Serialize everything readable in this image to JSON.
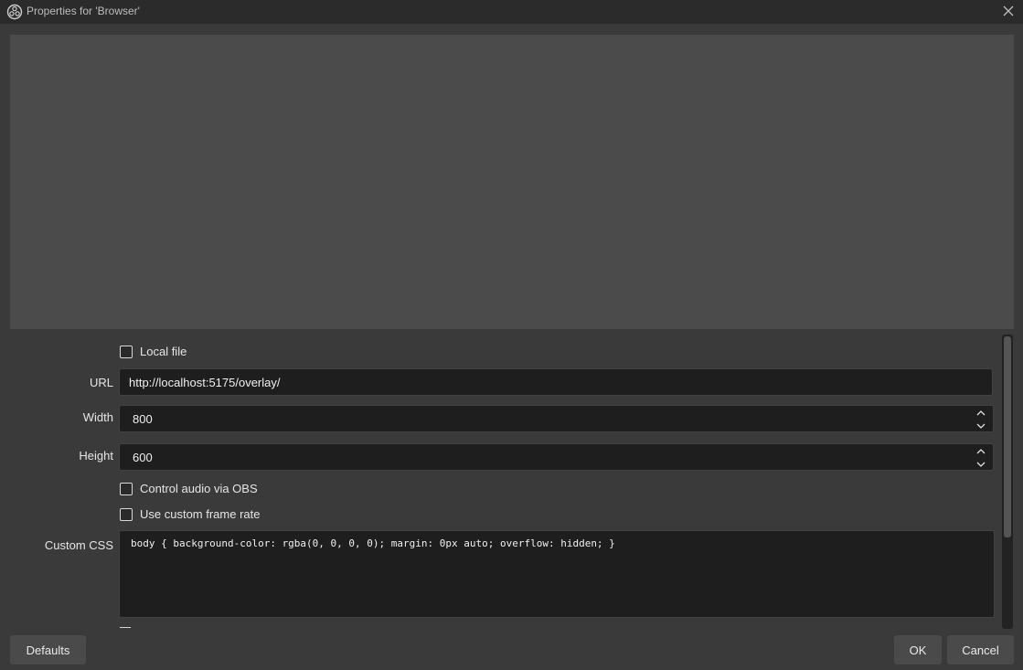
{
  "window": {
    "title": "Properties for 'Browser'"
  },
  "properties": {
    "local_file_label": "Local file",
    "url_label": "URL",
    "url_value": "http://localhost:5175/overlay/",
    "width_label": "Width",
    "width_value": "800",
    "height_label": "Height",
    "height_value": "600",
    "control_audio_label": "Control audio via OBS",
    "custom_frame_rate_label": "Use custom frame rate",
    "custom_css_label": "Custom CSS",
    "custom_css_value": "body { background-color: rgba(0, 0, 0, 0); margin: 0px auto; overflow: hidden; }"
  },
  "buttons": {
    "defaults": "Defaults",
    "ok": "OK",
    "cancel": "Cancel"
  },
  "colors": {
    "background": "#3a3a3a",
    "titlebar": "#2b2b2b",
    "preview": "#4b4b4b",
    "input": "#1e1e1e",
    "button": "#4a4a4a"
  },
  "icons": {
    "app": "obs-logo-icon",
    "close": "close-icon",
    "spin_up": "chevron-up-icon",
    "spin_down": "chevron-down-icon"
  }
}
